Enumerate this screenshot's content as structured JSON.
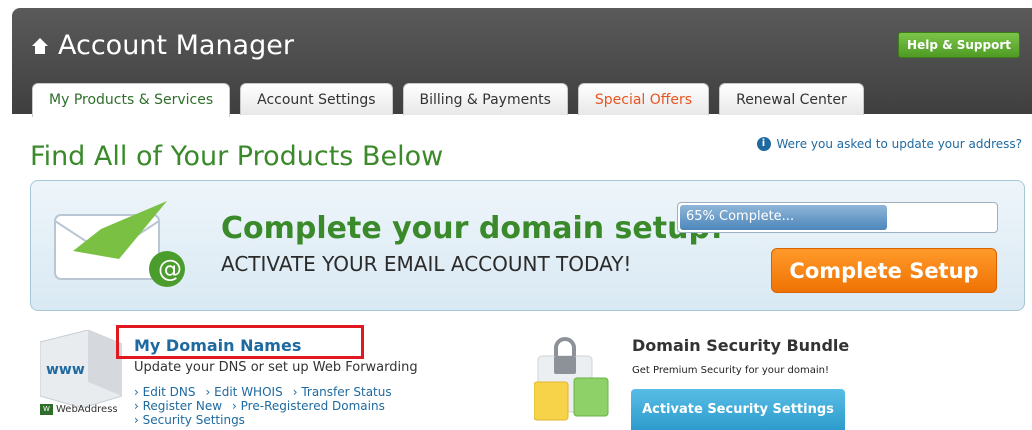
{
  "header": {
    "title": "Account Manager",
    "help_button": "Help & Support",
    "tabs": [
      {
        "label": "My Products & Services",
        "active": true
      },
      {
        "label": "Account Settings"
      },
      {
        "label": "Billing & Payments"
      },
      {
        "label": "Special Offers",
        "highlight_color": "#e8551f"
      },
      {
        "label": "Renewal Center"
      }
    ]
  },
  "page": {
    "heading": "Find All of Your Products Below",
    "address_notice": "Were you asked to update your address?"
  },
  "banner": {
    "headline": "Complete your domain setup!",
    "subline": "ACTIVATE YOUR EMAIL ACCOUNT TODAY!",
    "progress_text": "65% Complete...",
    "progress_value": 0.65,
    "button_label": "Complete Setup"
  },
  "domains": {
    "title": "My Domain Names",
    "description": "Update your DNS or set up Web Forwarding",
    "links_row1": [
      "Edit DNS",
      "Edit WHOIS",
      "Transfer Status"
    ],
    "links_row2": [
      "Register New",
      "Pre-Registered Domains"
    ],
    "links_row3": [
      "Security Settings"
    ],
    "brand": "WebAddress",
    "box_label": "www"
  },
  "security": {
    "title": "Domain Security Bundle",
    "description": "Get Premium Security for your domain!",
    "button_label": "Activate Security Settings"
  },
  "colors": {
    "header_bg": "#4b4b4b",
    "accent_green": "#3a8a2b",
    "link_blue": "#1e6aa0",
    "orange": "#ef7204"
  }
}
